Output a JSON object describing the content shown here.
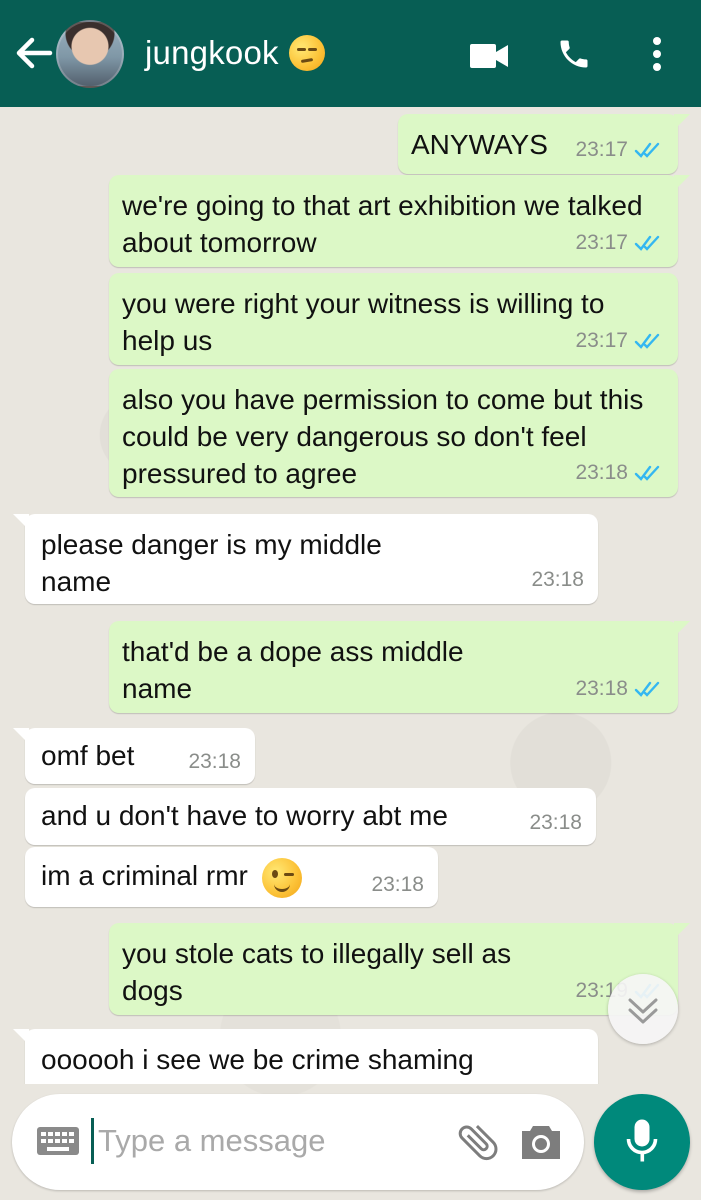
{
  "header": {
    "contact_name": "jungkook",
    "status_emoji": "unamused-face-emoji"
  },
  "messages": [
    {
      "dir": "out",
      "text": "ANYWAYS",
      "time": "23:17",
      "read": true
    },
    {
      "dir": "out",
      "text": "we're going to that art exhibition we talked about tomorrow",
      "time": "23:17",
      "read": true
    },
    {
      "dir": "out",
      "text": "you were right your witness is willing to help us",
      "time": "23:17",
      "read": true
    },
    {
      "dir": "out",
      "text": "also you have permission to come but this could be very dangerous so don't feel pressured to agree",
      "time": "23:18",
      "read": true
    },
    {
      "dir": "in",
      "text": "please danger is my middle name",
      "time": "23:18"
    },
    {
      "dir": "out",
      "text": "that'd be a dope ass middle name",
      "time": "23:18",
      "read": true
    },
    {
      "dir": "in",
      "text": "omf bet",
      "time": "23:18"
    },
    {
      "dir": "in",
      "text": "and u don't have to worry abt me",
      "time": "23:18"
    },
    {
      "dir": "in",
      "text": "im a criminal rmr",
      "emoji": "winking-face-emoji",
      "time": "23:18"
    },
    {
      "dir": "out",
      "text": "you stole cats to illegally sell as dogs",
      "time": "23:19",
      "read": true
    },
    {
      "dir": "in",
      "text": "oooooh i see we be crime shaming",
      "time": ""
    }
  ],
  "input": {
    "placeholder": "Type a message"
  },
  "colors": {
    "header": "#075e54",
    "outgoing_bubble": "#dcf8c6",
    "incoming_bubble": "#ffffff",
    "read_ticks": "#34b7f1",
    "mic_button": "#00897b"
  }
}
